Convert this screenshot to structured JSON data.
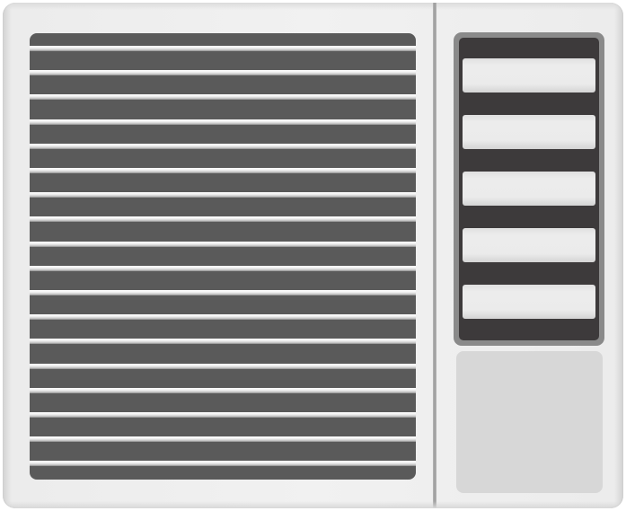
{
  "colors": {
    "casing": "#ececec",
    "casing_edge": "#d2d2d2",
    "divider": "#9a9a9a",
    "grille_background": "#5a5a5a",
    "slat_highlight": "#ffffff",
    "control_frame": "#8a8a8a",
    "control_background": "#3d3a3b",
    "louver": "#ebebeb",
    "filter_panel": "#d7d7d7"
  },
  "icons": {
    "grille": "front-air-grille",
    "vent": "air-direction-louvers",
    "panel": "filter-access-panel"
  },
  "grille": {
    "slat_count": 18
  },
  "vent": {
    "louver_count": 5
  }
}
